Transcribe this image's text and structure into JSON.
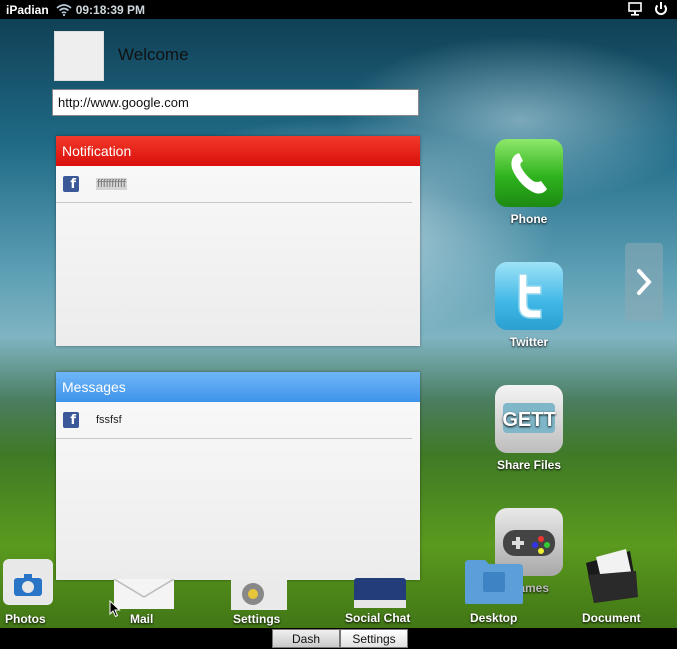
{
  "status_bar": {
    "brand": "iPadian",
    "time": "09:18:39 PM"
  },
  "profile": {
    "welcome": "Welcome"
  },
  "browser": {
    "url": "http://www.google.com"
  },
  "notification_panel": {
    "title": "Notification",
    "items": [
      {
        "icon": "facebook-icon",
        "text": "ffffffffff"
      }
    ]
  },
  "messages_panel": {
    "title": "Messages",
    "items": [
      {
        "icon": "facebook-icon",
        "text": "fssfsf"
      }
    ]
  },
  "apps": {
    "phone": "Phone",
    "twitter": "Twitter",
    "share_files": "Share Files",
    "games": "Games"
  },
  "dock": {
    "photos": "Photos",
    "mail": "Mail",
    "settings": "Settings",
    "social_chat": "Social Chat",
    "desktop": "Desktop",
    "document": "Document"
  },
  "bottom_tabs": {
    "dash": "Dash",
    "settings": "Settings"
  },
  "colors": {
    "notification_header": "#e01410",
    "messages_header": "#4a9cf0",
    "facebook": "#3b5998"
  }
}
